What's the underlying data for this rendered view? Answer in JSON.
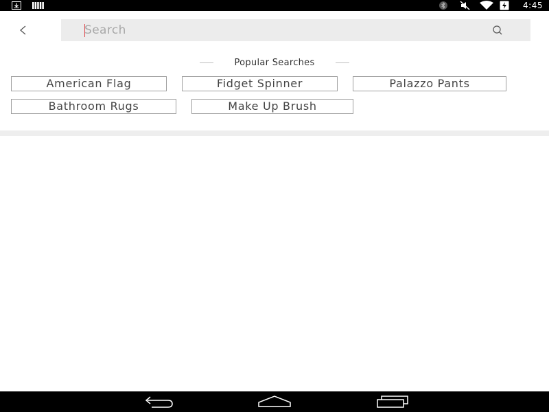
{
  "status_bar": {
    "time": "4:45",
    "left_icons": [
      "download-icon",
      "signal-bars-icon"
    ],
    "right_icons": [
      "bluetooth-icon",
      "mute-icon",
      "wifi-icon",
      "battery-charging-icon"
    ]
  },
  "header": {
    "back_icon": "back-chevron-icon",
    "search": {
      "placeholder": "Search",
      "value": "",
      "icon": "search-icon"
    }
  },
  "popular": {
    "heading": "Popular Searches",
    "chips": [
      {
        "label": "American Flag"
      },
      {
        "label": "Fidget Spinner"
      },
      {
        "label": "Palazzo Pants"
      },
      {
        "label": "Bathroom Rugs"
      },
      {
        "label": "Make Up Brush"
      }
    ]
  },
  "nav_bar": {
    "buttons": [
      "back-nav-icon",
      "home-nav-icon",
      "recents-nav-icon"
    ]
  },
  "colors": {
    "accent_cursor": "#e0474c",
    "search_bg": "#ececec",
    "chip_border": "#9e9e9e",
    "divider": "#eeeeee"
  }
}
